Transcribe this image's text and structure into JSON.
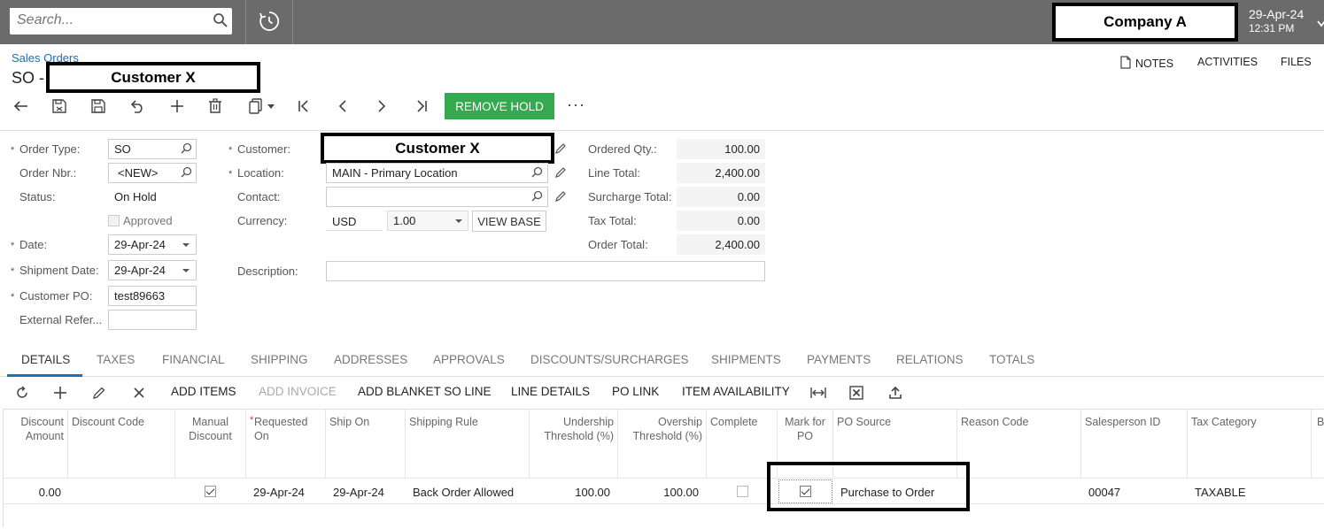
{
  "topbar": {
    "search_placeholder": "Search...",
    "company": "Company A",
    "date": "29-Apr-24",
    "time": "12:31 PM"
  },
  "header": {
    "breadcrumb": "Sales Orders",
    "title_prefix": "SO -",
    "title_customer": "Customer X",
    "links": {
      "notes": "NOTES",
      "activities": "ACTIVITIES",
      "files": "FILES"
    }
  },
  "toolbar": {
    "remove_hold": "REMOVE HOLD",
    "more": "···"
  },
  "form": {
    "order_type": {
      "label": "Order Type:",
      "value": "SO"
    },
    "order_nbr": {
      "label": "Order Nbr.:",
      "value": "<NEW>"
    },
    "status": {
      "label": "Status:",
      "value": "On Hold"
    },
    "approved": {
      "label": "Approved",
      "checked": false
    },
    "date": {
      "label": "Date:",
      "value": "29-Apr-24"
    },
    "shipment_date": {
      "label": "Shipment Date:",
      "value": "29-Apr-24"
    },
    "customer_po": {
      "label": "Customer PO:",
      "value": "test89663"
    },
    "external_ref": {
      "label": "External Refer...",
      "value": ""
    },
    "customer": {
      "label": "Customer:",
      "value": "Customer X"
    },
    "location": {
      "label": "Location:",
      "value": "MAIN - Primary Location"
    },
    "contact": {
      "label": "Contact:",
      "value": ""
    },
    "currency": {
      "label": "Currency:",
      "code": "USD",
      "rate": "1.00",
      "view_base": "VIEW BASE"
    },
    "description": {
      "label": "Description:",
      "value": ""
    },
    "ordered_qty": {
      "label": "Ordered Qty.:",
      "value": "100.00"
    },
    "line_total": {
      "label": "Line Total:",
      "value": "2,400.00"
    },
    "surcharge_total": {
      "label": "Surcharge Total:",
      "value": "0.00"
    },
    "tax_total": {
      "label": "Tax Total:",
      "value": "0.00"
    },
    "order_total": {
      "label": "Order Total:",
      "value": "2,400.00"
    }
  },
  "tabs": [
    "DETAILS",
    "TAXES",
    "FINANCIAL",
    "SHIPPING",
    "ADDRESSES",
    "APPROVALS",
    "DISCOUNTS/SURCHARGES",
    "SHIPMENTS",
    "PAYMENTS",
    "RELATIONS",
    "TOTALS"
  ],
  "grid_toolbar": {
    "add_items": "ADD ITEMS",
    "add_invoice": "ADD INVOICE",
    "add_blanket": "ADD BLANKET SO LINE",
    "line_details": "LINE DETAILS",
    "po_link": "PO LINK",
    "item_availability": "ITEM AVAILABILITY"
  },
  "grid": {
    "columns": {
      "discount_amount": "Discount Amount",
      "discount_code": "Discount Code",
      "manual_discount": "Manual Discount",
      "requested_on": "Requested On",
      "ship_on": "Ship On",
      "shipping_rule": "Shipping Rule",
      "undership": "Undership Threshold (%)",
      "overship": "Overship Threshold (%)",
      "completed": "Complete",
      "mark_for_po": "Mark for PO",
      "po_source": "PO Source",
      "reason_code": "Reason Code",
      "salesperson_id": "Salesperson ID",
      "tax_category": "Tax Category",
      "trailing": "Bi Ni"
    },
    "row": {
      "discount_amount": "0.00",
      "manual_discount": true,
      "requested_on": "29-Apr-24",
      "ship_on": "29-Apr-24",
      "shipping_rule": "Back Order Allowed",
      "undership": "100.00",
      "overship": "100.00",
      "completed": false,
      "mark_for_po": true,
      "po_source": "Purchase to Order",
      "salesperson_id": "00047",
      "tax_category": "TAXABLE"
    }
  },
  "colors": {
    "topbar": "#6b6b6b",
    "accent": "#1d6fb8",
    "remove_hold": "#35a94f"
  }
}
